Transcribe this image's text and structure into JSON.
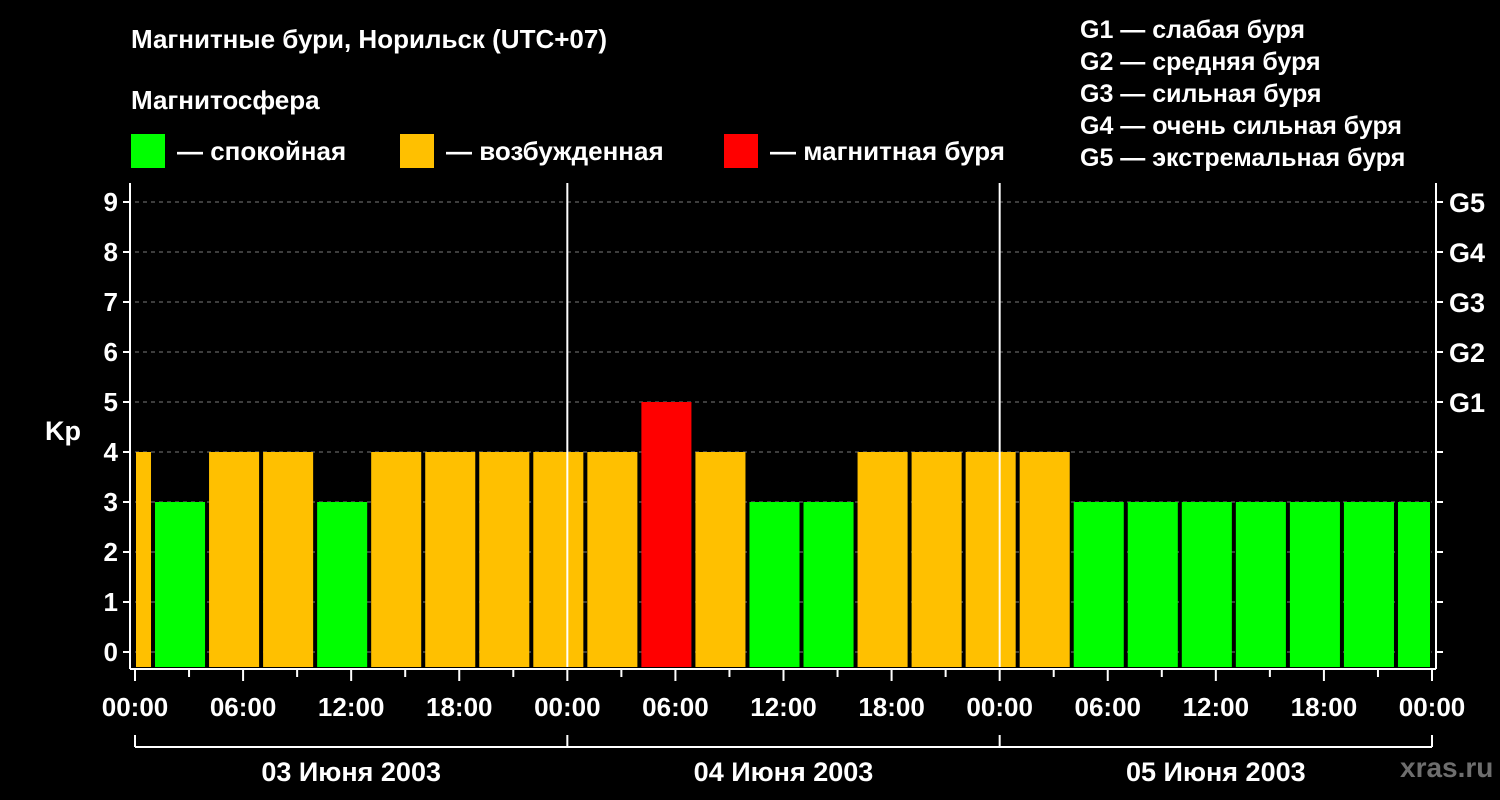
{
  "chart_data": {
    "type": "bar",
    "title": "Магнитные бури, Норильск (UTC+07)",
    "subtitle": "Магнитосфера",
    "ylabel": "Kp",
    "ylim": [
      0,
      9
    ],
    "yticks": [
      0,
      1,
      2,
      3,
      4,
      5,
      6,
      7,
      8,
      9
    ],
    "g_levels": [
      {
        "label": "G1",
        "kp": 5
      },
      {
        "label": "G2",
        "kp": 6
      },
      {
        "label": "G3",
        "kp": 7
      },
      {
        "label": "G4",
        "kp": 8
      },
      {
        "label": "G5",
        "kp": 9
      }
    ],
    "legend": [
      {
        "label": "— спокойная",
        "color": "#00ff00",
        "class": "quiet"
      },
      {
        "label": "— возбужденная",
        "color": "#ffc000",
        "class": "active"
      },
      {
        "label": "— магнитная буря",
        "color": "#ff0000",
        "class": "storm"
      }
    ],
    "g_scale_legend": [
      "G1 — слабая буря",
      "G2 — средняя буря",
      "G3 — сильная буря",
      "G4 — очень сильная буря",
      "G5 — экстремальная буря"
    ],
    "x_tick_labels": [
      "00:00",
      "06:00",
      "12:00",
      "18:00",
      "00:00",
      "06:00",
      "12:00",
      "18:00",
      "00:00",
      "06:00",
      "12:00",
      "18:00",
      "00:00"
    ],
    "day_labels": [
      "03 Июня 2003",
      "04 Июня 2003",
      "05 Июня 2003"
    ],
    "hours_range": [
      0,
      72
    ],
    "bars": [
      {
        "start": 0,
        "end": 1,
        "value": 4,
        "class": "active"
      },
      {
        "start": 1,
        "end": 4,
        "value": 3,
        "class": "quiet"
      },
      {
        "start": 4,
        "end": 7,
        "value": 4,
        "class": "active"
      },
      {
        "start": 7,
        "end": 10,
        "value": 4,
        "class": "active"
      },
      {
        "start": 10,
        "end": 13,
        "value": 3,
        "class": "quiet"
      },
      {
        "start": 13,
        "end": 16,
        "value": 4,
        "class": "active"
      },
      {
        "start": 16,
        "end": 19,
        "value": 4,
        "class": "active"
      },
      {
        "start": 19,
        "end": 22,
        "value": 4,
        "class": "active"
      },
      {
        "start": 22,
        "end": 25,
        "value": 4,
        "class": "active"
      },
      {
        "start": 25,
        "end": 28,
        "value": 4,
        "class": "active"
      },
      {
        "start": 28,
        "end": 31,
        "value": 5,
        "class": "storm"
      },
      {
        "start": 31,
        "end": 34,
        "value": 4,
        "class": "active"
      },
      {
        "start": 34,
        "end": 37,
        "value": 3,
        "class": "quiet"
      },
      {
        "start": 37,
        "end": 40,
        "value": 3,
        "class": "quiet"
      },
      {
        "start": 40,
        "end": 43,
        "value": 4,
        "class": "active"
      },
      {
        "start": 43,
        "end": 46,
        "value": 4,
        "class": "active"
      },
      {
        "start": 46,
        "end": 49,
        "value": 4,
        "class": "active"
      },
      {
        "start": 49,
        "end": 52,
        "value": 4,
        "class": "active"
      },
      {
        "start": 52,
        "end": 55,
        "value": 3,
        "class": "quiet"
      },
      {
        "start": 55,
        "end": 58,
        "value": 3,
        "class": "quiet"
      },
      {
        "start": 58,
        "end": 61,
        "value": 3,
        "class": "quiet"
      },
      {
        "start": 61,
        "end": 64,
        "value": 3,
        "class": "quiet"
      },
      {
        "start": 64,
        "end": 67,
        "value": 3,
        "class": "quiet"
      },
      {
        "start": 67,
        "end": 70,
        "value": 3,
        "class": "quiet"
      },
      {
        "start": 70,
        "end": 72,
        "value": 3,
        "class": "quiet"
      }
    ],
    "grid": true,
    "legend_position": "top"
  },
  "watermark": "xras.ru"
}
